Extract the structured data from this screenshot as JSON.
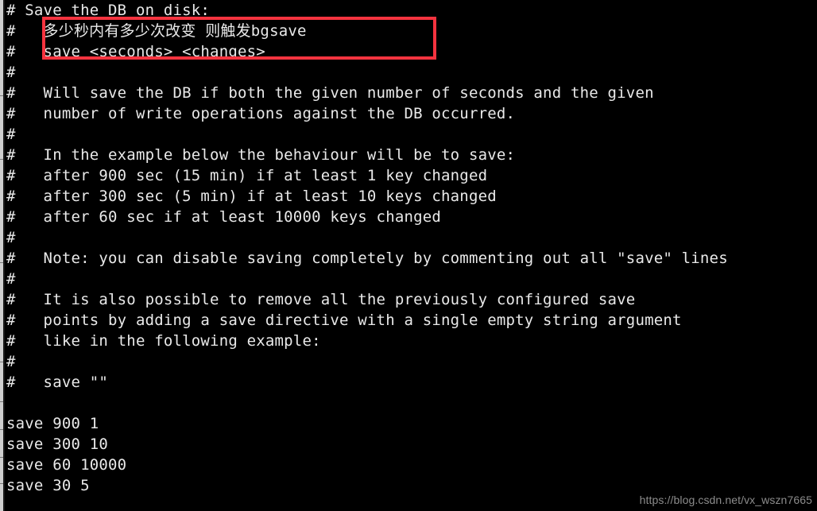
{
  "terminal": {
    "background_color": "#000000",
    "text_color": "#e9e9e9",
    "highlight_color": "#f5333f",
    "watermark_color": "#8c8c8c"
  },
  "lines": [
    {
      "id": "line-1",
      "text": "# Save the DB on disk:"
    },
    {
      "id": "line-2",
      "text": "#   多少秒内有多少次改变 则触发bgsave"
    },
    {
      "id": "line-3",
      "text": "#   save <seconds> <changes>"
    },
    {
      "id": "line-4",
      "text": "#"
    },
    {
      "id": "line-5",
      "text": "#   Will save the DB if both the given number of seconds and the given"
    },
    {
      "id": "line-6",
      "text": "#   number of write operations against the DB occurred."
    },
    {
      "id": "line-7",
      "text": "#"
    },
    {
      "id": "line-8",
      "text": "#   In the example below the behaviour will be to save:"
    },
    {
      "id": "line-9",
      "text": "#   after 900 sec (15 min) if at least 1 key changed"
    },
    {
      "id": "line-10",
      "text": "#   after 300 sec (5 min) if at least 10 keys changed"
    },
    {
      "id": "line-11",
      "text": "#   after 60 sec if at least 10000 keys changed"
    },
    {
      "id": "line-12",
      "text": "#"
    },
    {
      "id": "line-13",
      "text": "#   Note: you can disable saving completely by commenting out all \"save\" lines"
    },
    {
      "id": "line-14",
      "text": "#"
    },
    {
      "id": "line-15",
      "text": "#   It is also possible to remove all the previously configured save"
    },
    {
      "id": "line-16",
      "text": "#   points by adding a save directive with a single empty string argument"
    },
    {
      "id": "line-17",
      "text": "#   like in the following example:"
    },
    {
      "id": "line-18",
      "text": "#"
    },
    {
      "id": "line-19",
      "text": "#   save \"\""
    },
    {
      "id": "line-20",
      "text": ""
    },
    {
      "id": "line-21",
      "text": "save 900 1"
    },
    {
      "id": "line-22",
      "text": "save 300 10"
    },
    {
      "id": "line-23",
      "text": "save 60 10000"
    },
    {
      "id": "line-24",
      "text": "save 30 5"
    }
  ],
  "highlight": {
    "note": "red rectangle around the Chinese annotation and save syntax lines",
    "color": "#f5333f"
  },
  "watermark": {
    "text": "https://blog.csdn.net/vx_wszn7665"
  }
}
